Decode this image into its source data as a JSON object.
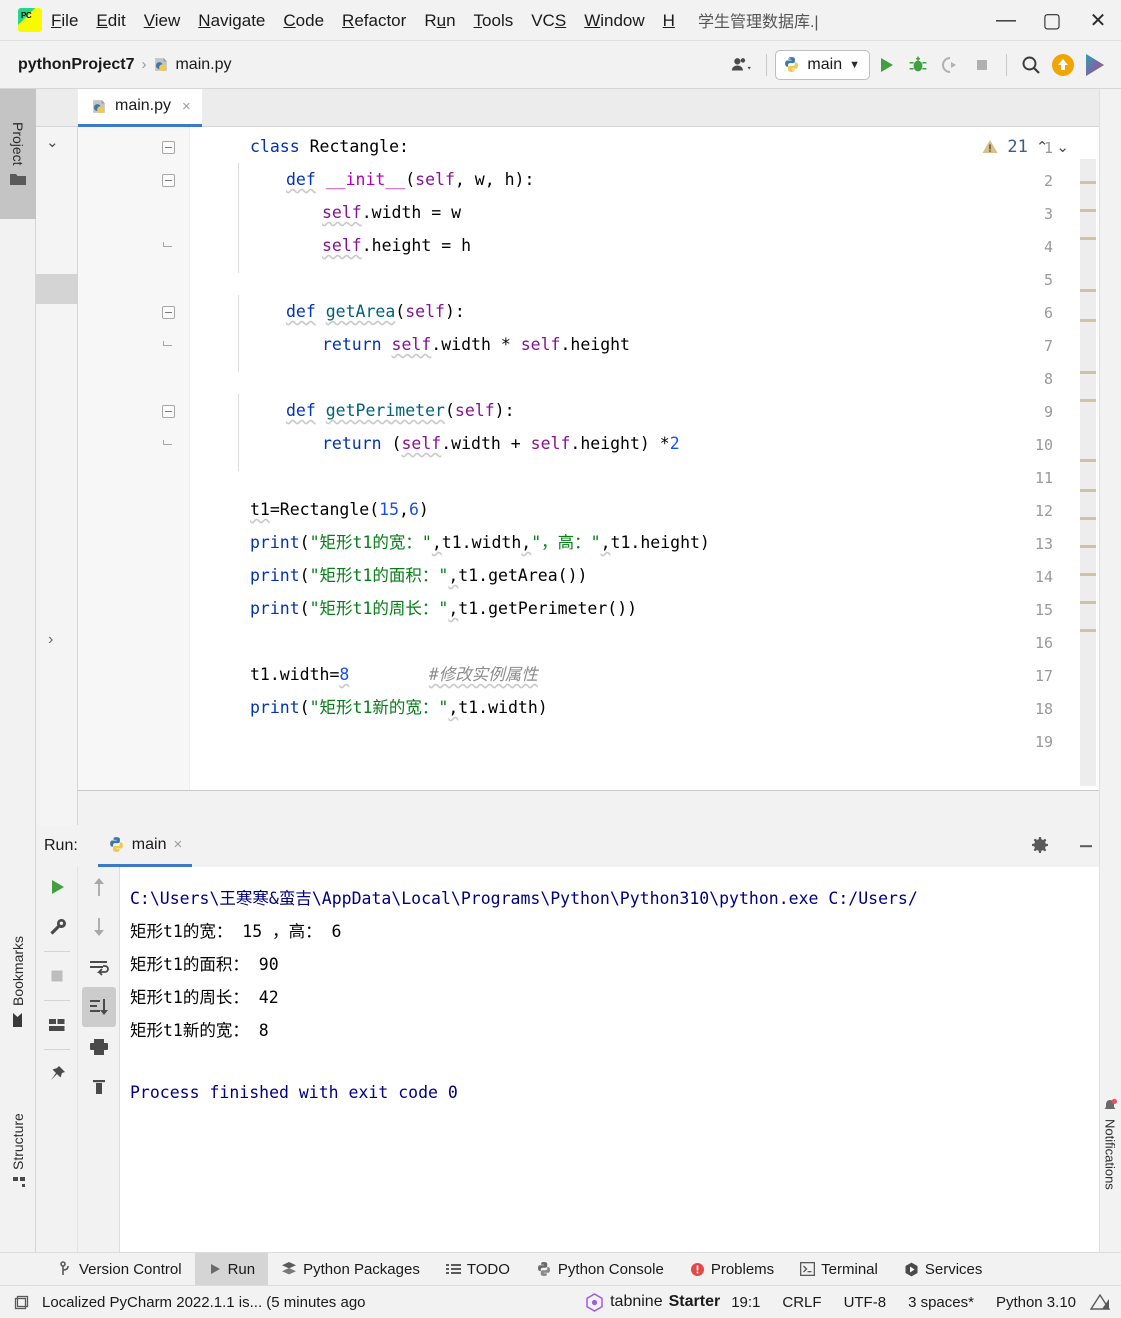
{
  "window": {
    "title": "学生管理数据库.|",
    "minimize": "—",
    "maximize": "▢",
    "close": "✕"
  },
  "menubar": {
    "logo": "pycharm-logo",
    "items": [
      {
        "label": "File",
        "accel": "F"
      },
      {
        "label": "Edit",
        "accel": "E"
      },
      {
        "label": "View",
        "accel": "V"
      },
      {
        "label": "Navigate",
        "accel": "N"
      },
      {
        "label": "Code",
        "accel": "C"
      },
      {
        "label": "Refactor",
        "accel": "R"
      },
      {
        "label": "Run",
        "accel": "u"
      },
      {
        "label": "Tools",
        "accel": "T"
      },
      {
        "label": "VCS",
        "accel": "S"
      },
      {
        "label": "Window",
        "accel": "W"
      },
      {
        "label": "H",
        "accel": "H"
      }
    ]
  },
  "navbar": {
    "project": "pythonProject7",
    "separator": "›",
    "file": "main.py",
    "run_config": "main",
    "icons": [
      "user-dropdown-icon",
      "run-icon",
      "debug-icon",
      "coverage-icon",
      "stop-icon",
      "search-icon",
      "update-icon",
      "ide-assist-icon"
    ]
  },
  "left_stripe": {
    "tabs": [
      {
        "label": "Project",
        "selected": true
      },
      {
        "label": "Bookmarks",
        "selected": false
      },
      {
        "label": "Structure",
        "selected": false
      }
    ]
  },
  "editor": {
    "tab": {
      "label": "main.py",
      "close": "×"
    },
    "inspection": {
      "count": "21",
      "up": "⌃",
      "down": "⌄"
    },
    "lines": [
      {
        "n": "1",
        "fold": "start"
      },
      {
        "n": "2",
        "fold": "start"
      },
      {
        "n": "3",
        "fold": ""
      },
      {
        "n": "4",
        "fold": "end"
      },
      {
        "n": "5",
        "fold": ""
      },
      {
        "n": "6",
        "fold": "start"
      },
      {
        "n": "7",
        "fold": "end"
      },
      {
        "n": "8",
        "fold": ""
      },
      {
        "n": "9",
        "fold": "start"
      },
      {
        "n": "10",
        "fold": "end"
      },
      {
        "n": "11",
        "fold": ""
      },
      {
        "n": "12",
        "fold": ""
      },
      {
        "n": "13",
        "fold": ""
      },
      {
        "n": "14",
        "fold": ""
      },
      {
        "n": "15",
        "fold": ""
      },
      {
        "n": "16",
        "fold": ""
      },
      {
        "n": "17",
        "fold": ""
      },
      {
        "n": "18",
        "fold": ""
      },
      {
        "n": "19",
        "fold": ""
      }
    ],
    "code": {
      "l1": "class Rectangle:",
      "l2": "    def __init__(self, w, h):",
      "l3": "        self.width = w",
      "l4": "        self.height = h",
      "l5": "",
      "l6": "    def getArea(self):",
      "l7": "        return self.width * self.height",
      "l8": "",
      "l9": "    def getPerimeter(self):",
      "l10": "        return (self.width + self.height) *2",
      "l11": "",
      "l12": "t1=Rectangle(15,6)",
      "l13": "print(\"矩形t1的宽：\",t1.width,\"，高：\",t1.height)",
      "l14": "print(\"矩形t1的面积：\",t1.getArea())",
      "l15": "print(\"矩形t1的周长：\",t1.getPerimeter())",
      "l16": "",
      "l17": "t1.width=8        #修改实例属性",
      "l18": "print(\"矩形t1新的宽：\",t1.width)",
      "l19": ""
    }
  },
  "run_panel": {
    "label": "Run:",
    "tab": "main",
    "tab_close": "×",
    "settings_icon": "gear-icon",
    "minimize_icon": "minimize-icon",
    "toolbar_left": [
      "rerun-icon",
      "wrench-icon",
      "stop-icon",
      "layout-icon",
      "pin-icon"
    ],
    "toolbar_right": [
      "up-arrow-icon",
      "down-arrow-icon",
      "soft-wrap-icon",
      "scroll-to-end-icon",
      "print-icon",
      "trash-icon"
    ],
    "console": [
      "C:\\Users\\王寒寒&蛮吉\\AppData\\Local\\Programs\\Python\\Python310\\python.exe C:/Users/",
      "矩形t1的宽： 15 ，高： 6",
      "矩形t1的面积： 90",
      "矩形t1的周长： 42",
      "矩形t1新的宽： 8",
      "",
      "Process finished with exit code 0"
    ]
  },
  "right_stripe": {
    "notifications": "Notifications"
  },
  "bottom_tabs": [
    {
      "label": "Version Control",
      "icon": "branch-icon",
      "selected": false
    },
    {
      "label": "Run",
      "icon": "play-icon",
      "selected": true
    },
    {
      "label": "Python Packages",
      "icon": "packages-icon",
      "selected": false
    },
    {
      "label": "TODO",
      "icon": "list-icon",
      "selected": false
    },
    {
      "label": "Python Console",
      "icon": "python-icon",
      "selected": false
    },
    {
      "label": "Problems",
      "icon": "problems-icon",
      "selected": false
    },
    {
      "label": "Terminal",
      "icon": "terminal-icon",
      "selected": false
    },
    {
      "label": "Services",
      "icon": "services-icon",
      "selected": false
    }
  ],
  "statusbar": {
    "message": "Localized PyCharm 2022.1.1 is... (5 minutes ago",
    "tabnine": "tabnine",
    "tabnine_plan": "Starter",
    "caret": "19:1",
    "line_sep": "CRLF",
    "encoding": "UTF-8",
    "indent": "3 spaces*",
    "interpreter": "Python 3.10"
  },
  "colors": {
    "accent_blue": "#3c79c8",
    "keyword": "#0033b3",
    "string": "#067d17",
    "number": "#1750eb",
    "comment": "#8c8c8c",
    "self": "#871094",
    "func": "#00627a",
    "console_text": "#000080",
    "warning": "#c9ae6a"
  }
}
